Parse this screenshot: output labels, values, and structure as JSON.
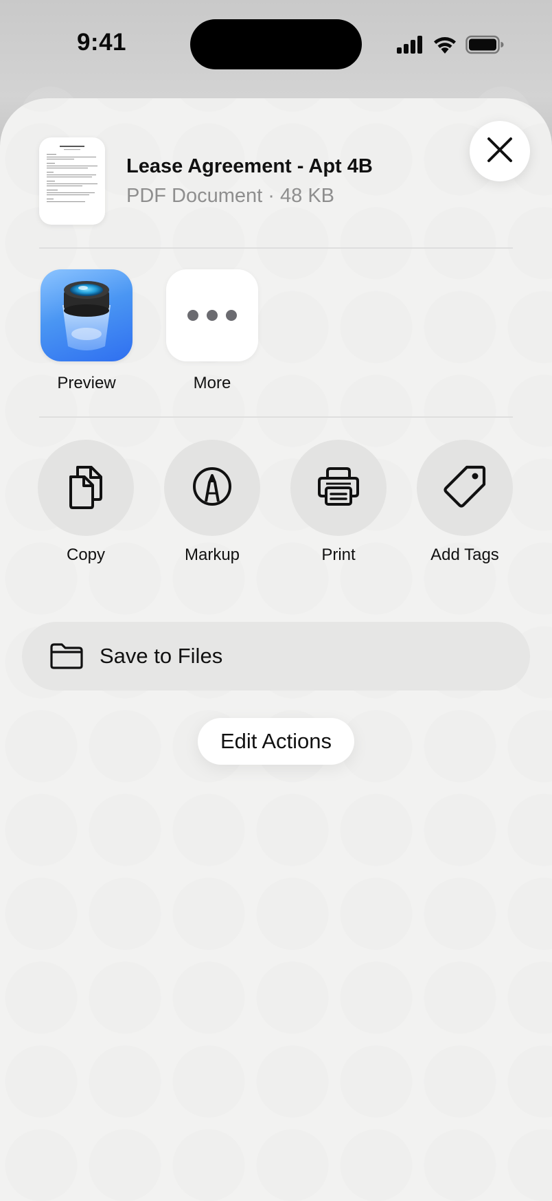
{
  "status_bar": {
    "time": "9:41",
    "icons": [
      "cellular-signal-icon",
      "wifi-icon",
      "battery-icon"
    ]
  },
  "share_sheet": {
    "document": {
      "title": "Lease Agreement - Apt 4B",
      "subtitle": "PDF Document · 48 KB",
      "thumbnail_icon": "pdf-document-thumbnail"
    },
    "close_icon": "close-icon",
    "apps": [
      {
        "label": "Preview",
        "icon": "preview-app-icon"
      },
      {
        "label": "More",
        "icon": "more-dots-icon"
      }
    ],
    "actions": [
      {
        "label": "Copy",
        "icon": "copy-documents-icon"
      },
      {
        "label": "Markup",
        "icon": "markup-pen-icon"
      },
      {
        "label": "Print",
        "icon": "printer-icon"
      },
      {
        "label": "Add Tags",
        "icon": "tag-icon"
      }
    ],
    "save_to_files": {
      "label": "Save to Files",
      "icon": "folder-icon"
    },
    "edit_actions_label": "Edit Actions"
  },
  "colors": {
    "sheet_background": "#f2f2f1",
    "action_circle": "#e3e3e2",
    "secondary_text": "#8e8e8e",
    "preview_blue": "#4a96f3"
  }
}
